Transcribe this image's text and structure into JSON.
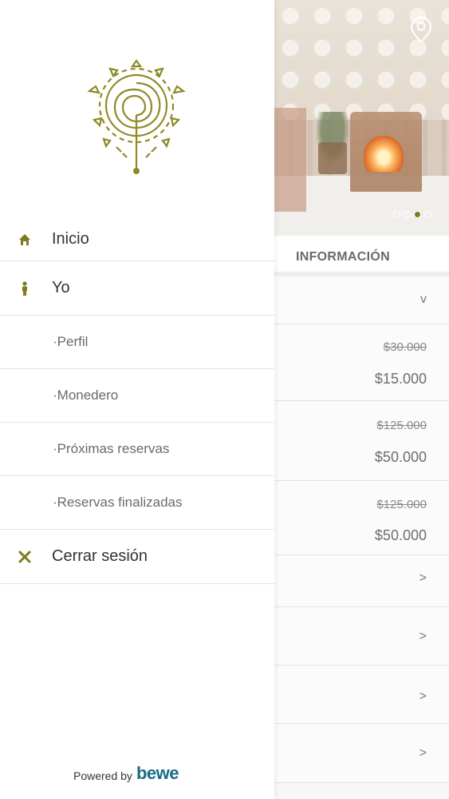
{
  "drawer": {
    "menu": [
      {
        "label": "Inicio",
        "icon": "home-icon"
      },
      {
        "label": "Yo",
        "icon": "person-icon"
      },
      {
        "label": "·Perfil"
      },
      {
        "label": "·Monedero"
      },
      {
        "label": "·Próximas reservas"
      },
      {
        "label": "·Reservas finalizadas"
      },
      {
        "label": "Cerrar sesión",
        "icon": "close-icon"
      }
    ],
    "footer": {
      "powered_by": "Powered by",
      "brand": "bewe"
    }
  },
  "background_page": {
    "section_title": "INFORMACIÓN",
    "carousel": {
      "slides": 4,
      "active_index": 2
    },
    "collapse_indicator": "v",
    "prices": [
      {
        "old": "$30.000",
        "new": "$15.000"
      },
      {
        "old": "$125.000",
        "new": "$50.000"
      },
      {
        "old": "$125.000",
        "new": "$50.000"
      }
    ],
    "chevrons": [
      ">",
      ">",
      ">",
      ">"
    ]
  },
  "colors": {
    "accent": "#7f7a1a",
    "brand": "#1a6b86"
  }
}
